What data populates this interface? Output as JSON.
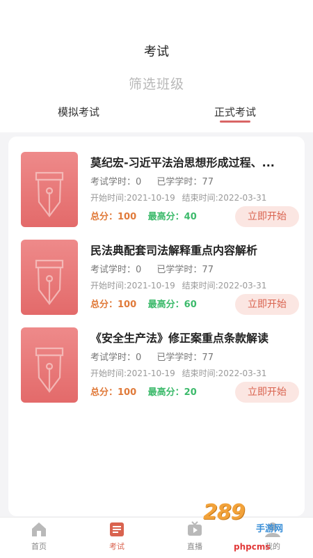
{
  "header": {
    "title": "考试",
    "filter_label": "筛选班级",
    "tabs": [
      {
        "label": "模拟考试",
        "active": false
      },
      {
        "label": "正式考试",
        "active": true
      }
    ]
  },
  "exams": [
    {
      "title": "莫纪宏-习近平法治思想形成过程、...",
      "hours_label": "考试学时：0",
      "learned_label": "已学学时：77",
      "start_label": "开始时间:2021-10-19",
      "end_label": "结束时间:2022-03-31",
      "total_label": "总分：100",
      "max_label": "最高分：40",
      "button_label": "立即开始"
    },
    {
      "title": "民法典配套司法解释重点内容解析",
      "hours_label": "考试学时：0",
      "learned_label": "已学学时：77",
      "start_label": "开始时间:2021-10-19",
      "end_label": "结束时间:2022-03-31",
      "total_label": "总分：100",
      "max_label": "最高分：60",
      "button_label": "立即开始"
    },
    {
      "title": "《安全生产法》修正案重点条款解读",
      "hours_label": "考试学时：0",
      "learned_label": "已学学时：77",
      "start_label": "开始时间:2021-10-19",
      "end_label": "结束时间:2022-03-31",
      "total_label": "总分：100",
      "max_label": "最高分：20",
      "button_label": "立即开始"
    }
  ],
  "nav": [
    {
      "label": "首页",
      "icon": "home-icon",
      "active": false
    },
    {
      "label": "考试",
      "icon": "exam-icon",
      "active": true
    },
    {
      "label": "直播",
      "icon": "live-tv-icon",
      "active": false
    },
    {
      "label": "我的",
      "icon": "profile-icon",
      "active": false
    }
  ],
  "watermark": {
    "logo": "289",
    "sub": "手游网",
    "url": "phpcms"
  },
  "colors": {
    "accent": "#d9634f",
    "thumb": "#e8777a",
    "score_total": "#e07a3a",
    "score_max": "#3cba6b",
    "button_bg": "#fbe6e2"
  }
}
